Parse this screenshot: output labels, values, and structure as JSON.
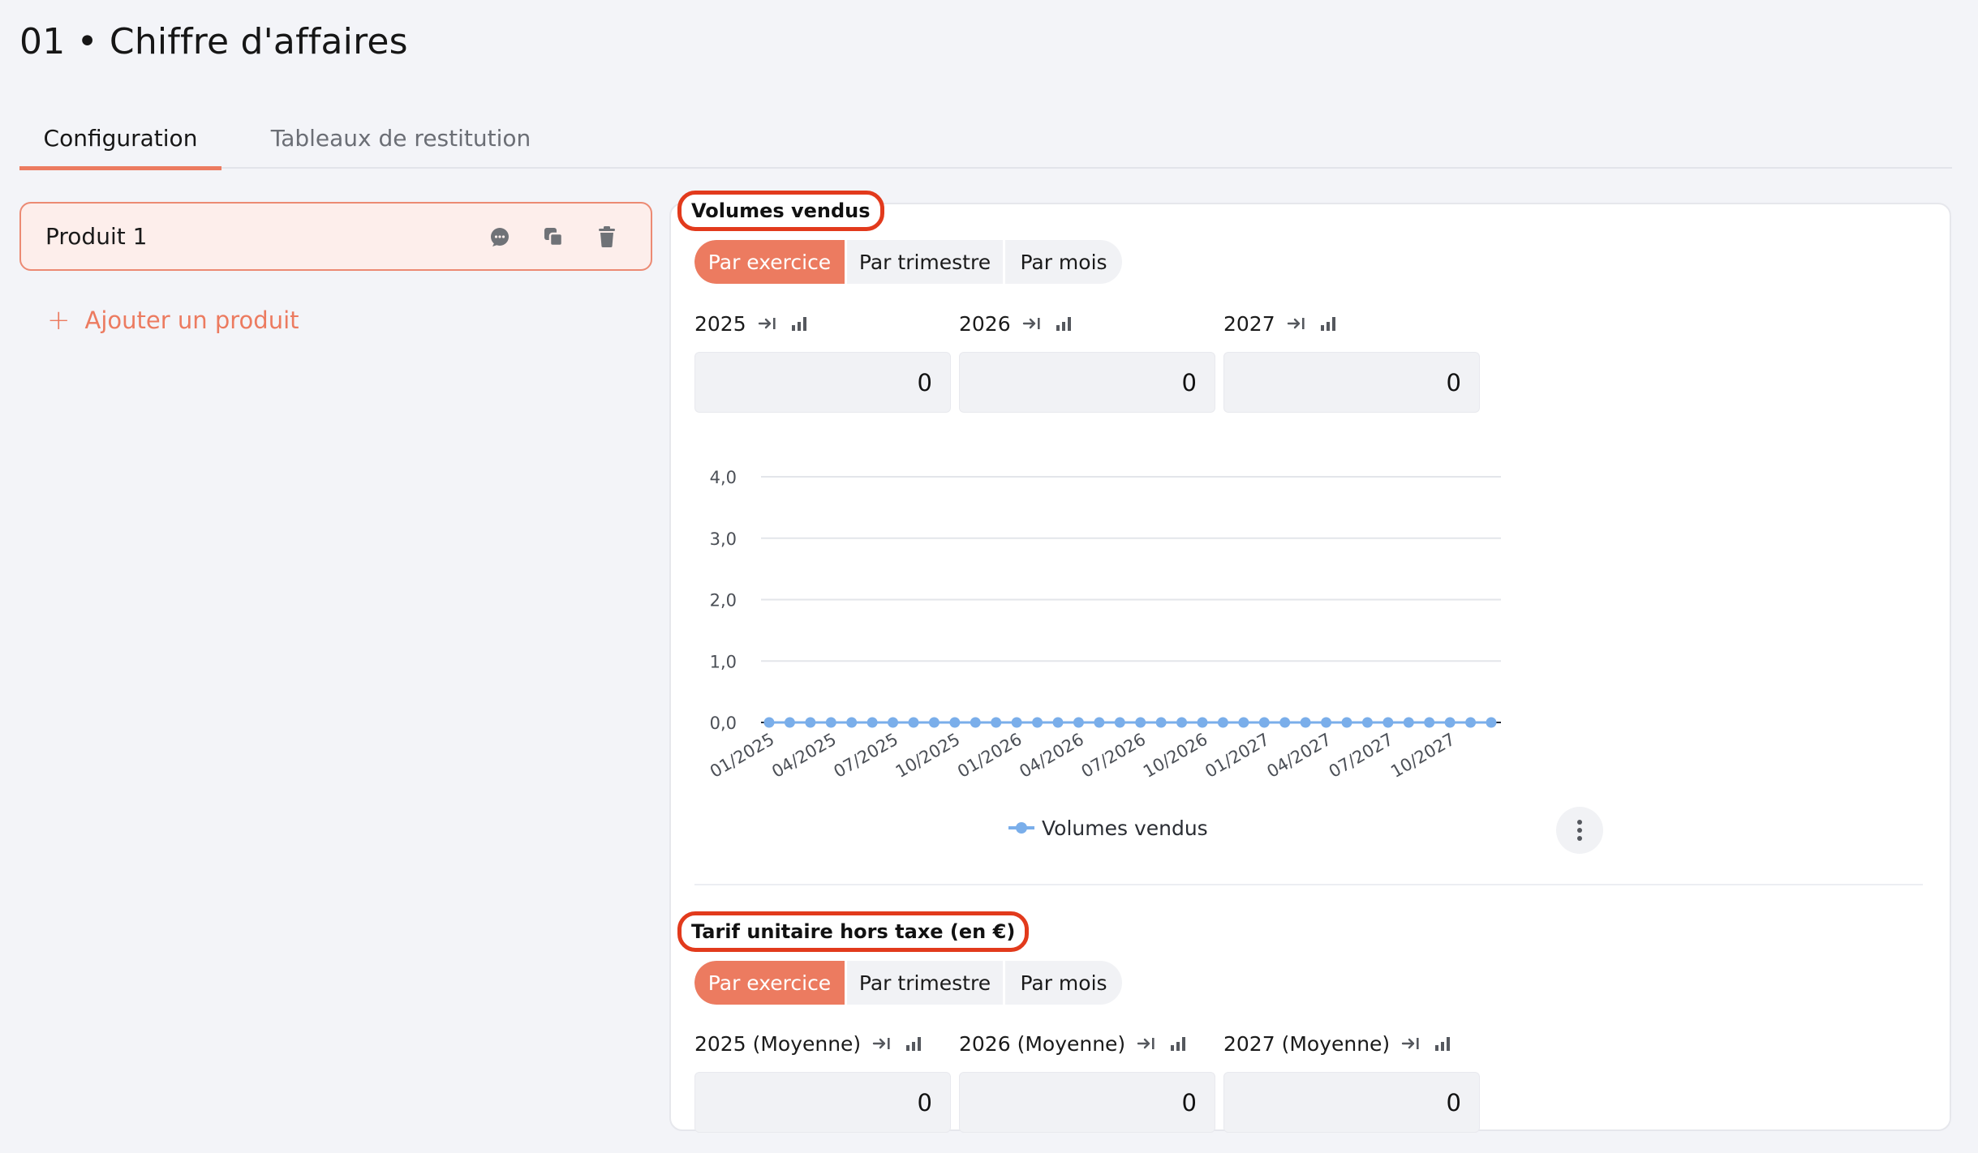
{
  "page": {
    "title": "01 • Chiffre d'affaires"
  },
  "tabs": [
    {
      "label": "Configuration",
      "active": true
    },
    {
      "label": "Tableaux de restitution",
      "active": false
    }
  ],
  "products": {
    "items": [
      {
        "name": "Produit 1"
      }
    ],
    "add_label": "Ajouter un produit",
    "add_icon": "plus-icon"
  },
  "colors": {
    "accent": "#ec7b60",
    "highlight_border": "#e23a1c",
    "series": "#7aaeea"
  },
  "sections": [
    {
      "title": "Volumes vendus",
      "segments": [
        "Par exercice",
        "Par trimestre",
        "Par mois"
      ],
      "active_segment": "Par exercice",
      "years": [
        {
          "label": "2025",
          "value": "0"
        },
        {
          "label": "2026",
          "value": "0"
        },
        {
          "label": "2027",
          "value": "0"
        }
      ]
    },
    {
      "title": "Tarif unitaire hors taxe (en €)",
      "segments": [
        "Par exercice",
        "Par trimestre",
        "Par mois"
      ],
      "active_segment": "Par exercice",
      "years": [
        {
          "label": "2025 (Moyenne)",
          "value": "0"
        },
        {
          "label": "2026 (Moyenne)",
          "value": "0"
        },
        {
          "label": "2027 (Moyenne)",
          "value": "0"
        }
      ]
    }
  ],
  "chart_data": {
    "type": "line",
    "x": [
      "01/2025",
      "02/2025",
      "03/2025",
      "04/2025",
      "05/2025",
      "06/2025",
      "07/2025",
      "08/2025",
      "09/2025",
      "10/2025",
      "11/2025",
      "12/2025",
      "01/2026",
      "02/2026",
      "03/2026",
      "04/2026",
      "05/2026",
      "06/2026",
      "07/2026",
      "08/2026",
      "09/2026",
      "10/2026",
      "11/2026",
      "12/2026",
      "01/2027",
      "02/2027",
      "03/2027",
      "04/2027",
      "05/2027",
      "06/2027",
      "07/2027",
      "08/2027",
      "09/2027",
      "10/2027",
      "11/2027",
      "12/2027"
    ],
    "x_tick_labels": [
      "01/2025",
      "04/2025",
      "07/2025",
      "10/2025",
      "01/2026",
      "04/2026",
      "07/2026",
      "10/2026",
      "01/2027",
      "04/2027",
      "07/2027",
      "10/2027"
    ],
    "y_tick_labels": [
      "0,0",
      "1,0",
      "2,0",
      "3,0",
      "4,0"
    ],
    "ylim": [
      0,
      4
    ],
    "series": [
      {
        "name": "Volumes vendus",
        "values": [
          0,
          0,
          0,
          0,
          0,
          0,
          0,
          0,
          0,
          0,
          0,
          0,
          0,
          0,
          0,
          0,
          0,
          0,
          0,
          0,
          0,
          0,
          0,
          0,
          0,
          0,
          0,
          0,
          0,
          0,
          0,
          0,
          0,
          0,
          0,
          0
        ]
      }
    ],
    "grid": true,
    "legend": "bottom"
  }
}
